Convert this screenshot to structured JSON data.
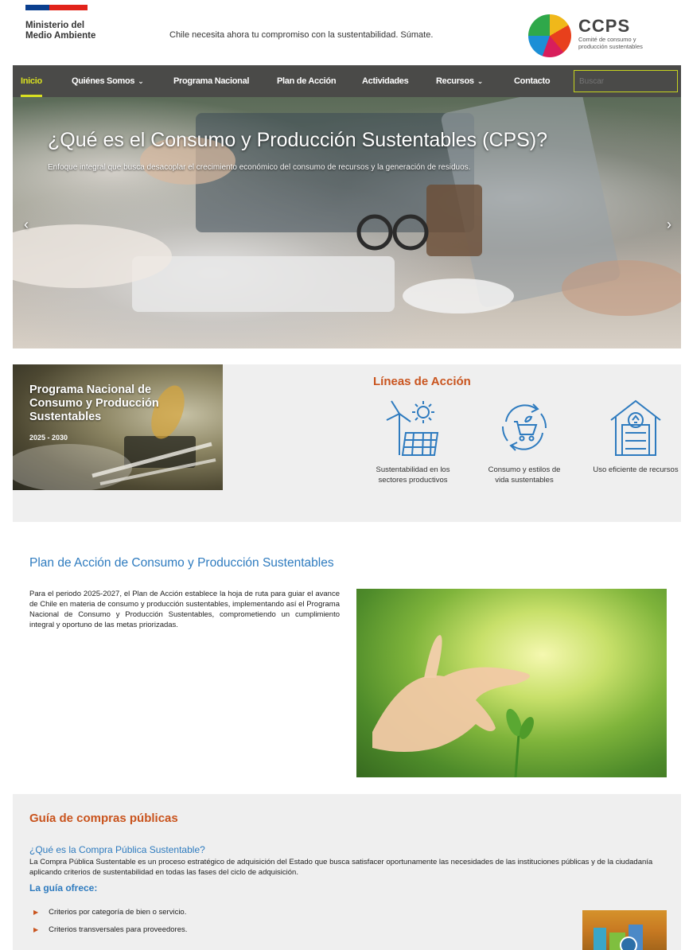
{
  "header": {
    "ministry": "Ministerio del Medio Ambiente",
    "tagline": "Chile necesita ahora tu compromiso con la sustentabilidad. Súmate.",
    "logo_title": "CCPS",
    "logo_subtitle": "Comité de consumo y producción sustentables"
  },
  "nav": {
    "items": [
      {
        "label": "Inicio"
      },
      {
        "label": "Quiénes Somos"
      },
      {
        "label": "Programa Nacional"
      },
      {
        "label": "Plan de Acción"
      },
      {
        "label": "Actividades"
      },
      {
        "label": "Recursos"
      },
      {
        "label": "Contacto"
      }
    ],
    "chevron": "⌄",
    "search_placeholder": "Buscar"
  },
  "hero": {
    "title": "¿Qué es el Consumo y Producción Sustentables (CPS)?",
    "subtitle": "Enfoque integral que busca desacoplar el crecimiento económico del consumo de recursos y la generación de residuos.",
    "prev": "‹",
    "next": "›"
  },
  "program": {
    "title": "Programa Nacional de Consumo y Producción Sustentables",
    "years": "2025 - 2030"
  },
  "lines": {
    "title": "Líneas de Acción",
    "items": [
      {
        "label": "Sustentabilidad en los sectores productivos",
        "icon": "wind-solar-icon"
      },
      {
        "label": "Consumo y estilos de vida sustentables",
        "icon": "recycle-cart-icon"
      },
      {
        "label": "Uso eficiente de recursos",
        "icon": "recycle-house-icon"
      }
    ]
  },
  "plan": {
    "title": "Plan de Acción de Consumo y Producción Sustentables",
    "text": "Para el periodo 2025-2027, el Plan de Acción establece la hoja de ruta para guiar el avance de Chile en materia de consumo y producción sustentables, implementando así el Programa Nacional de Consumo y Producción Sustentables, comprometiendo un cumplimiento integral y oportuno de las metas priorizadas."
  },
  "guide": {
    "title": "Guía de compras públicas",
    "question": "¿Qué es la Compra Pública Sustentable?",
    "text": "La Compra Pública Sustentable es un proceso estratégico de adquisición del Estado que busca satisfacer oportunamente las necesidades de las instituciones públicas y de la ciudadanía aplicando criterios de sustentabilidad en todas las fases del ciclo de adquisición.",
    "offer_title": "La guía ofrece:",
    "bullet": "▶",
    "items": [
      "Criterios por categoría de bien o servicio.",
      "Criterios transversales para proveedores."
    ]
  },
  "colors": {
    "nav_bg": "#4a4a48",
    "nav_active": "#d9e021",
    "accent_orange": "#c9541e",
    "accent_blue": "#2e7bbf",
    "section_bg": "#efefef"
  }
}
